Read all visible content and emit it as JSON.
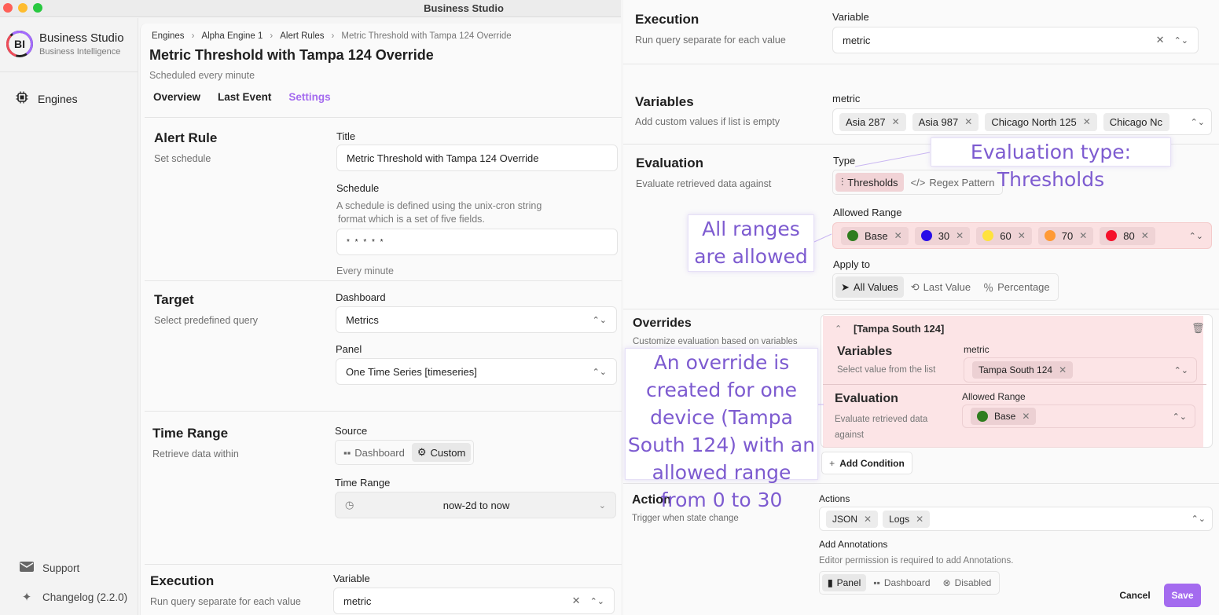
{
  "window": {
    "title": "Business Studio"
  },
  "sidebar": {
    "brand_logo": "BI",
    "brand_name": "Business Studio",
    "brand_subtitle": "Business Intelligence",
    "items": [
      {
        "label": "Engines",
        "icon": "cpu-chip-icon"
      }
    ],
    "bottom_items": [
      {
        "label": "Support",
        "icon": "envelope-icon"
      },
      {
        "label": "Changelog (2.2.0)",
        "icon": "sparkles-icon"
      }
    ]
  },
  "header": {
    "breadcrumb": [
      "Engines",
      "Alpha Engine 1",
      "Alert Rules",
      "Metric Threshold with Tampa 124 Override"
    ],
    "title": "Metric Threshold with Tampa 124 Override",
    "subtitle": "Scheduled every minute",
    "tabs": [
      {
        "label": "Overview",
        "active": false
      },
      {
        "label": "Last Event",
        "active": false
      },
      {
        "label": "Settings",
        "active": true
      }
    ]
  },
  "alert_rule": {
    "title": "Alert Rule",
    "subtitle": "Set schedule",
    "title_label": "Title",
    "title_value": "Metric Threshold with Tampa 124 Override",
    "schedule_label": "Schedule",
    "schedule_hint_1": "A schedule is defined using the unix-cron string",
    "schedule_hint_2": "format which is a set of five fields.",
    "schedule_value": "* * * * *",
    "schedule_readable": "Every minute"
  },
  "target": {
    "title": "Target",
    "subtitle": "Select predefined query",
    "dashboard_label": "Dashboard",
    "dashboard_value": "Metrics",
    "panel_label": "Panel",
    "panel_value": "One Time Series [timeseries]"
  },
  "time_range": {
    "title": "Time Range",
    "subtitle": "Retrieve data within",
    "source_label": "Source",
    "source_options": [
      {
        "label": "Dashboard",
        "icon": "grid-icon",
        "selected": false
      },
      {
        "label": "Custom",
        "icon": "gear-icon",
        "selected": true
      }
    ],
    "range_label": "Time Range",
    "range_value": "now-2d to now"
  },
  "execution": {
    "title": "Execution",
    "subtitle": "Run query separate for each value",
    "variable_label": "Variable",
    "variable_value": "metric"
  },
  "variables": {
    "title": "Variables",
    "subtitle": "Add custom values if list is empty",
    "field_label": "metric",
    "values": [
      "Asia 287",
      "Asia 987",
      "Chicago North 125",
      "Chicago Nc"
    ]
  },
  "evaluation": {
    "title": "Evaluation",
    "subtitle": "Evaluate retrieved data against",
    "type_label": "Type",
    "type_options": [
      {
        "label": "Thresholds",
        "icon": "sliders-icon",
        "selected": true
      },
      {
        "label": "Regex Pattern",
        "icon": "code-icon",
        "selected": false
      }
    ],
    "range_label": "Allowed Range",
    "ranges": [
      {
        "label": "Base",
        "color": "#2e7d1e"
      },
      {
        "label": "30",
        "color": "#2a0ee8"
      },
      {
        "label": "60",
        "color": "#ffe23d"
      },
      {
        "label": "70",
        "color": "#ff9a35"
      },
      {
        "label": "80",
        "color": "#f5112b"
      }
    ],
    "apply_label": "Apply to",
    "apply_options": [
      {
        "label": "All Values",
        "icon": "send-icon",
        "selected": true
      },
      {
        "label": "Last Value",
        "icon": "history-icon",
        "selected": false
      },
      {
        "label": "Percentage",
        "icon": "percent-icon",
        "selected": false
      }
    ]
  },
  "overrides": {
    "title": "Overrides",
    "subtitle": "Customize evaluation based on variables",
    "items": [
      {
        "name": "[Tampa South 124]",
        "variables_title": "Variables",
        "variables_sub": "Select value from the list",
        "variable_label": "metric",
        "variable_values": [
          "Tampa South 124"
        ],
        "evaluation_title": "Evaluation",
        "evaluation_sub": "Evaluate retrieved data against",
        "range_label": "Allowed Range",
        "ranges": [
          {
            "label": "Base",
            "color": "#2e7d1e"
          }
        ]
      }
    ],
    "add_condition_label": "Add Condition"
  },
  "action": {
    "title": "Action",
    "subtitle": "Trigger when state change",
    "actions_label": "Actions",
    "actions": [
      "JSON",
      "Logs"
    ],
    "annotations_label": "Add Annotations",
    "annotations_hint": "Editor permission is required to add Annotations.",
    "annotation_options": [
      {
        "label": "Panel",
        "icon": "bar-chart-icon",
        "selected": true
      },
      {
        "label": "Dashboard",
        "icon": "grid-icon",
        "selected": false
      },
      {
        "label": "Disabled",
        "icon": "x-circle-icon",
        "selected": false
      }
    ]
  },
  "footer": {
    "cancel_label": "Cancel",
    "save_label": "Save",
    "accent": "#a46bef"
  },
  "annotations_overlay": {
    "type_note": "Evaluation type: Thresholds",
    "range_note": "All ranges are allowed",
    "override_note": "An override is created for one device (Tampa South 124) with an allowed range from 0 to 30"
  }
}
